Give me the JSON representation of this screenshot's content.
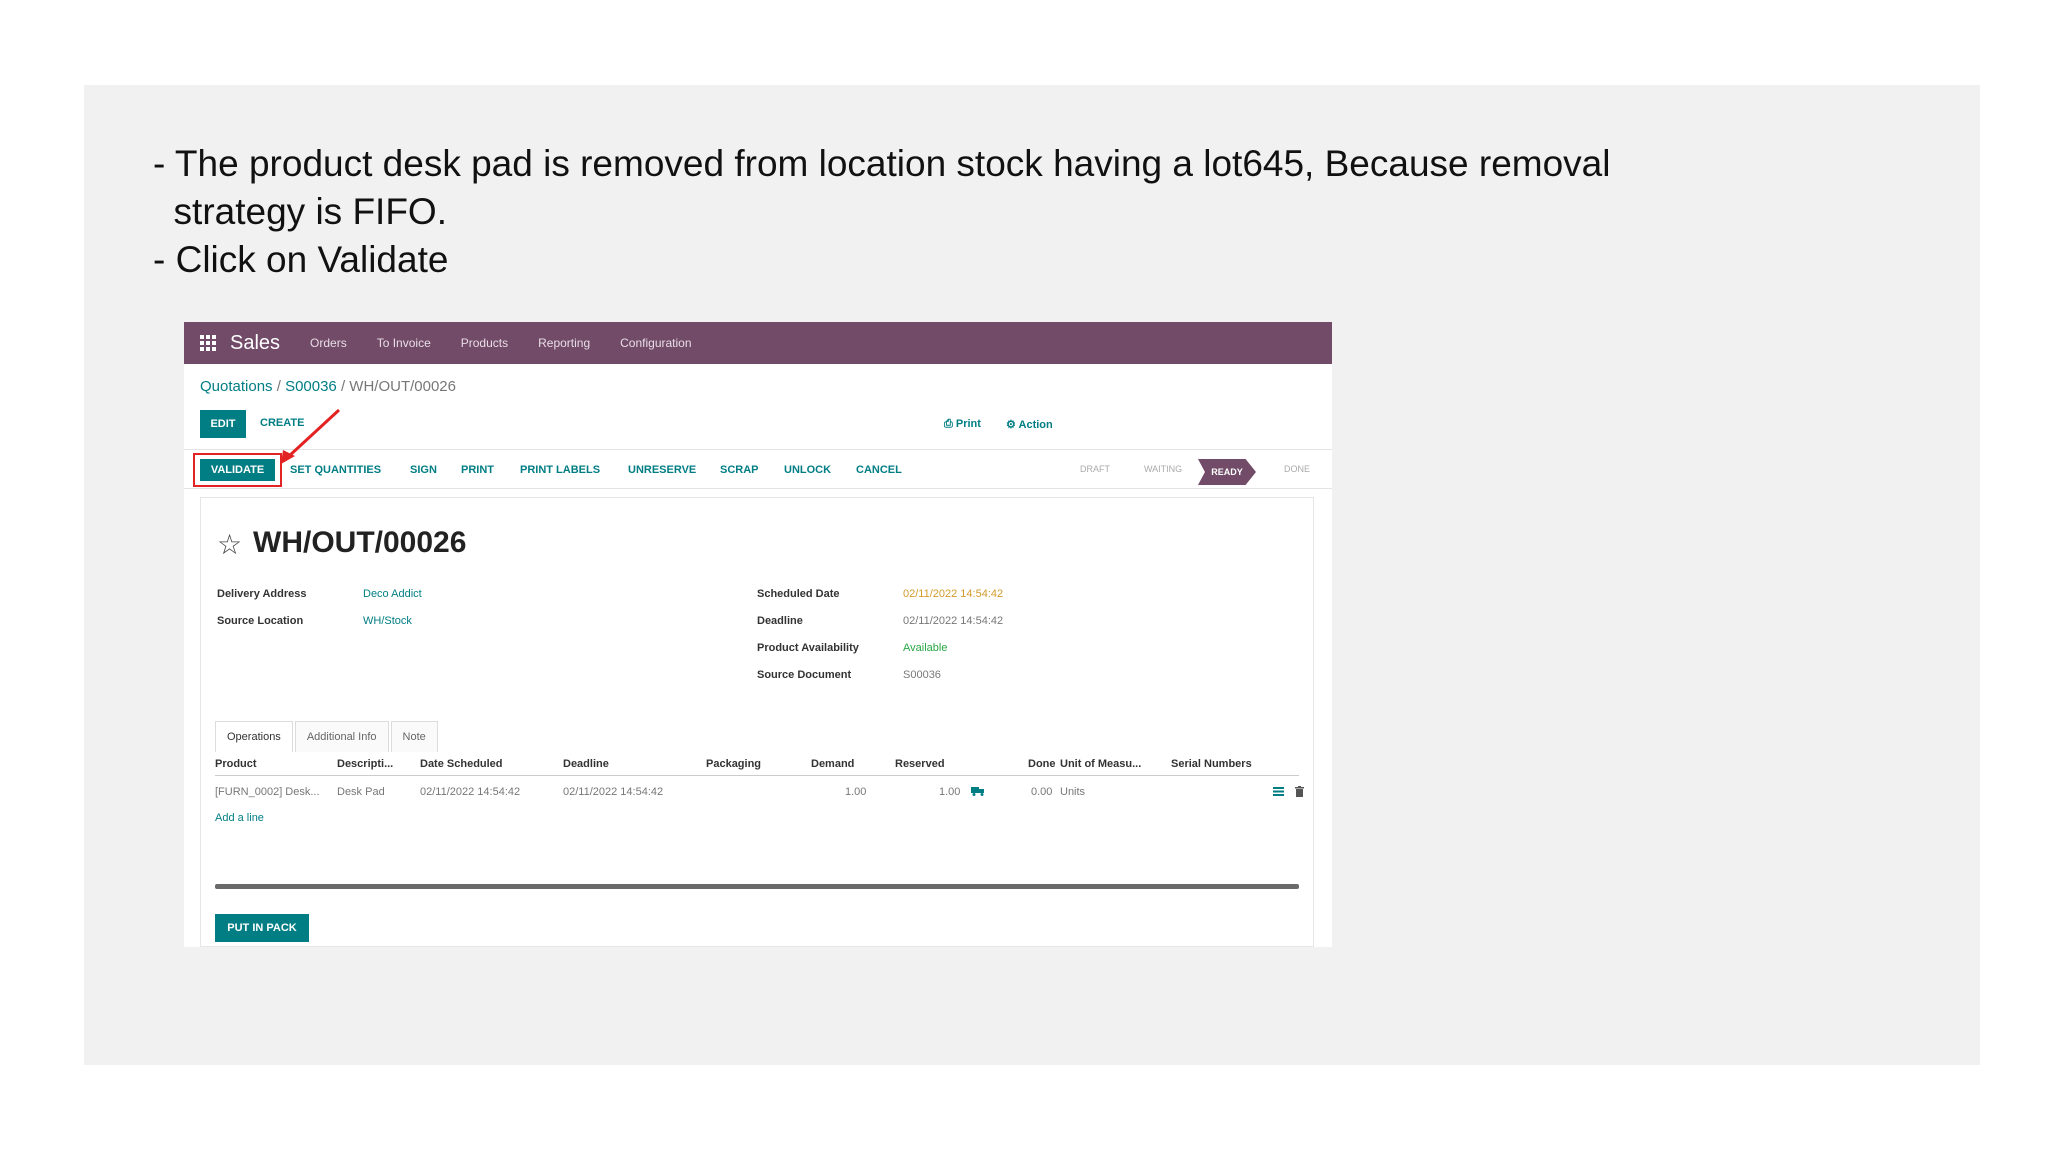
{
  "caption": {
    "line1": "- The product desk pad is removed from location stock having a lot645, Because removal",
    "line2": "  strategy is FIFO.",
    "line3": "- Click on Validate"
  },
  "navbar": {
    "app_name": "Sales",
    "menu": [
      "Orders",
      "To Invoice",
      "Products",
      "Reporting",
      "Configuration"
    ]
  },
  "breadcrumb": {
    "quotations": "Quotations",
    "sep1": " / ",
    "order": "S00036",
    "sep2": " / ",
    "current": "WH/OUT/00026"
  },
  "control_panel": {
    "edit": "EDIT",
    "create": "CREATE",
    "print": "Print",
    "action": "Action"
  },
  "actions": {
    "validate": "VALIDATE",
    "set_quantities": "SET QUANTITIES",
    "sign": "SIGN",
    "print": "PRINT",
    "print_labels": "PRINT LABELS",
    "unreserve": "UNRESERVE",
    "scrap": "SCRAP",
    "unlock": "UNLOCK",
    "cancel": "CANCEL"
  },
  "statusbar": {
    "draft": "DRAFT",
    "waiting": "WAITING",
    "ready": "READY",
    "done": "DONE"
  },
  "record": {
    "title": "WH/OUT/00026",
    "delivery_address_label": "Delivery Address",
    "delivery_address": "Deco Addict",
    "source_location_label": "Source Location",
    "source_location": "WH/Stock",
    "scheduled_date_label": "Scheduled Date",
    "scheduled_date": "02/11/2022 14:54:42",
    "deadline_label": "Deadline",
    "deadline": "02/11/2022 14:54:42",
    "availability_label": "Product Availability",
    "availability": "Available",
    "source_document_label": "Source Document",
    "source_document": "S00036"
  },
  "tabs": [
    "Operations",
    "Additional Info",
    "Note"
  ],
  "table": {
    "headers": [
      "Product",
      "Descripti...",
      "Date Scheduled",
      "Deadline",
      "Packaging",
      "Demand",
      "Reserved",
      "Done",
      "Unit of Measu...",
      "Serial Numbers"
    ],
    "row": {
      "product": "[FURN_0002] Desk...",
      "description": "Desk Pad",
      "date_scheduled": "02/11/2022 14:54:42",
      "deadline": "02/11/2022 14:54:42",
      "packaging": "",
      "demand": "1.00",
      "reserved": "1.00",
      "done": "0.00",
      "uom": "Units",
      "serials": ""
    },
    "add_line": "Add a line"
  },
  "footer": {
    "put_in_pack": "PUT IN PACK"
  },
  "colors": {
    "brand": "#714b67",
    "accent": "#017e84",
    "highlight": "#e32323"
  }
}
